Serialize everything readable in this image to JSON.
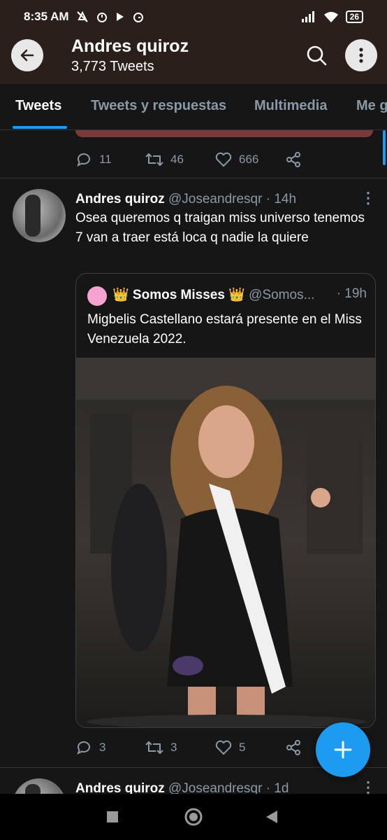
{
  "status_bar": {
    "time": "8:35 AM",
    "battery": "26",
    "icons": [
      "mute-icon",
      "alarm-icon",
      "play-icon",
      "alarm-icon",
      "signal-icon",
      "wifi-icon",
      "battery-icon"
    ]
  },
  "header": {
    "title": "Andres quiroz",
    "subtitle": "3,773 Tweets"
  },
  "tabs": [
    {
      "label": "Tweets",
      "active": true
    },
    {
      "label": "Tweets y respuestas",
      "active": false
    },
    {
      "label": "Multimedia",
      "active": false
    },
    {
      "label": "Me g",
      "active": false
    }
  ],
  "prev_tweet_actions": {
    "replies": "11",
    "retweets": "46",
    "likes": "666"
  },
  "tweet": {
    "name": "Andres quiroz",
    "handle": "@Joseandresqr",
    "time": "· 14h",
    "text": "Osea queremos q traigan miss universo tenemos 7 van a traer está loca q nadie la quiere",
    "quote": {
      "name": "👑 Somos Misses 👑",
      "handle": "@Somos...",
      "time": "· 19h",
      "text": "Migbelis Castellano estará presente en el Miss Venezuela 2022."
    },
    "actions": {
      "replies": "3",
      "retweets": "3",
      "likes": "5"
    }
  },
  "next_tweet": {
    "name": "Andres quiroz",
    "handle": "@Joseandresqr",
    "time": "· 1d"
  },
  "colors": {
    "accent": "#1d9bf0",
    "header_bg": "#2b1f1c",
    "feed_bg": "#161616"
  }
}
